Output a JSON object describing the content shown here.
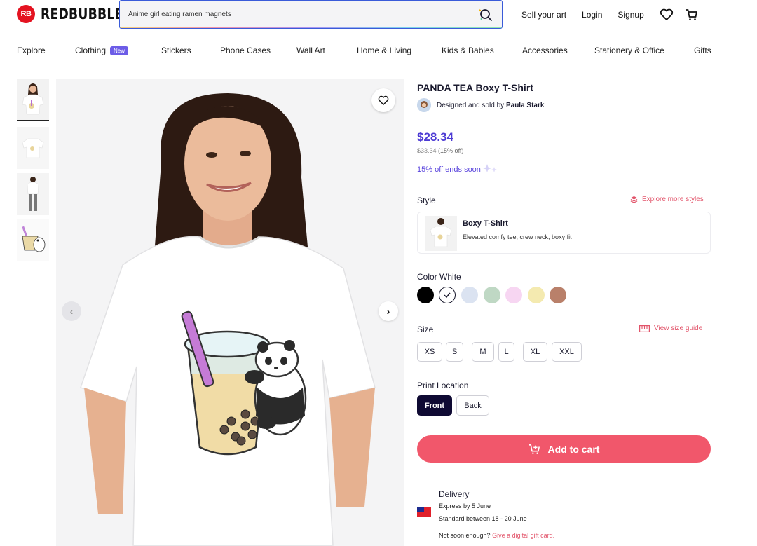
{
  "header": {
    "logo_text": "REDBUBBLE",
    "logo_badge": "RB",
    "search_value": "Anime girl eating ramen magnets",
    "links": [
      "Sell your art",
      "Login",
      "Signup"
    ]
  },
  "nav": {
    "items": [
      "Explore",
      "Clothing",
      "Stickers",
      "Phone Cases",
      "Wall Art",
      "Home & Living",
      "Kids & Babies",
      "Accessories",
      "Stationery & Office",
      "Gifts"
    ],
    "new_badge": "New"
  },
  "product": {
    "title": "PANDA TEA Boxy T-Shirt",
    "seller_prefix": "Designed and sold by",
    "seller_name": "Paula Stark",
    "price": "$28.34",
    "old_price": "$33.34",
    "discount": "(15% off)",
    "sale_text": "15% off ends soon"
  },
  "style": {
    "label": "Style",
    "explore_link": "Explore more styles",
    "name": "Boxy T-Shirt",
    "description": "Elevated comfy tee, crew neck, boxy fit"
  },
  "color": {
    "label": "Color",
    "selected": "White",
    "swatches": [
      "#000000",
      "#ffffff",
      "#dbe3f1",
      "#bfd8c4",
      "#f7d6f2",
      "#f4eab0",
      "#b9806a"
    ]
  },
  "size": {
    "label": "Size",
    "guide_link": "View size guide",
    "options": [
      "XS",
      "S",
      "M",
      "L",
      "XL",
      "XXL"
    ]
  },
  "print_location": {
    "label": "Print Location",
    "options": [
      "Front",
      "Back"
    ],
    "selected": "Front"
  },
  "cart": {
    "label": "Add to cart"
  },
  "delivery": {
    "title": "Delivery",
    "express": "Express by 5 June",
    "standard": "Standard between 18 - 20 June",
    "not_soon": "Not soon enough?",
    "gift_link": "Give a digital gift card."
  },
  "colors": {
    "brand_red": "#e41321",
    "accent_purple": "#4d3bd4",
    "cart_pink": "#f1576b",
    "dark_navy": "#0f0a33"
  }
}
